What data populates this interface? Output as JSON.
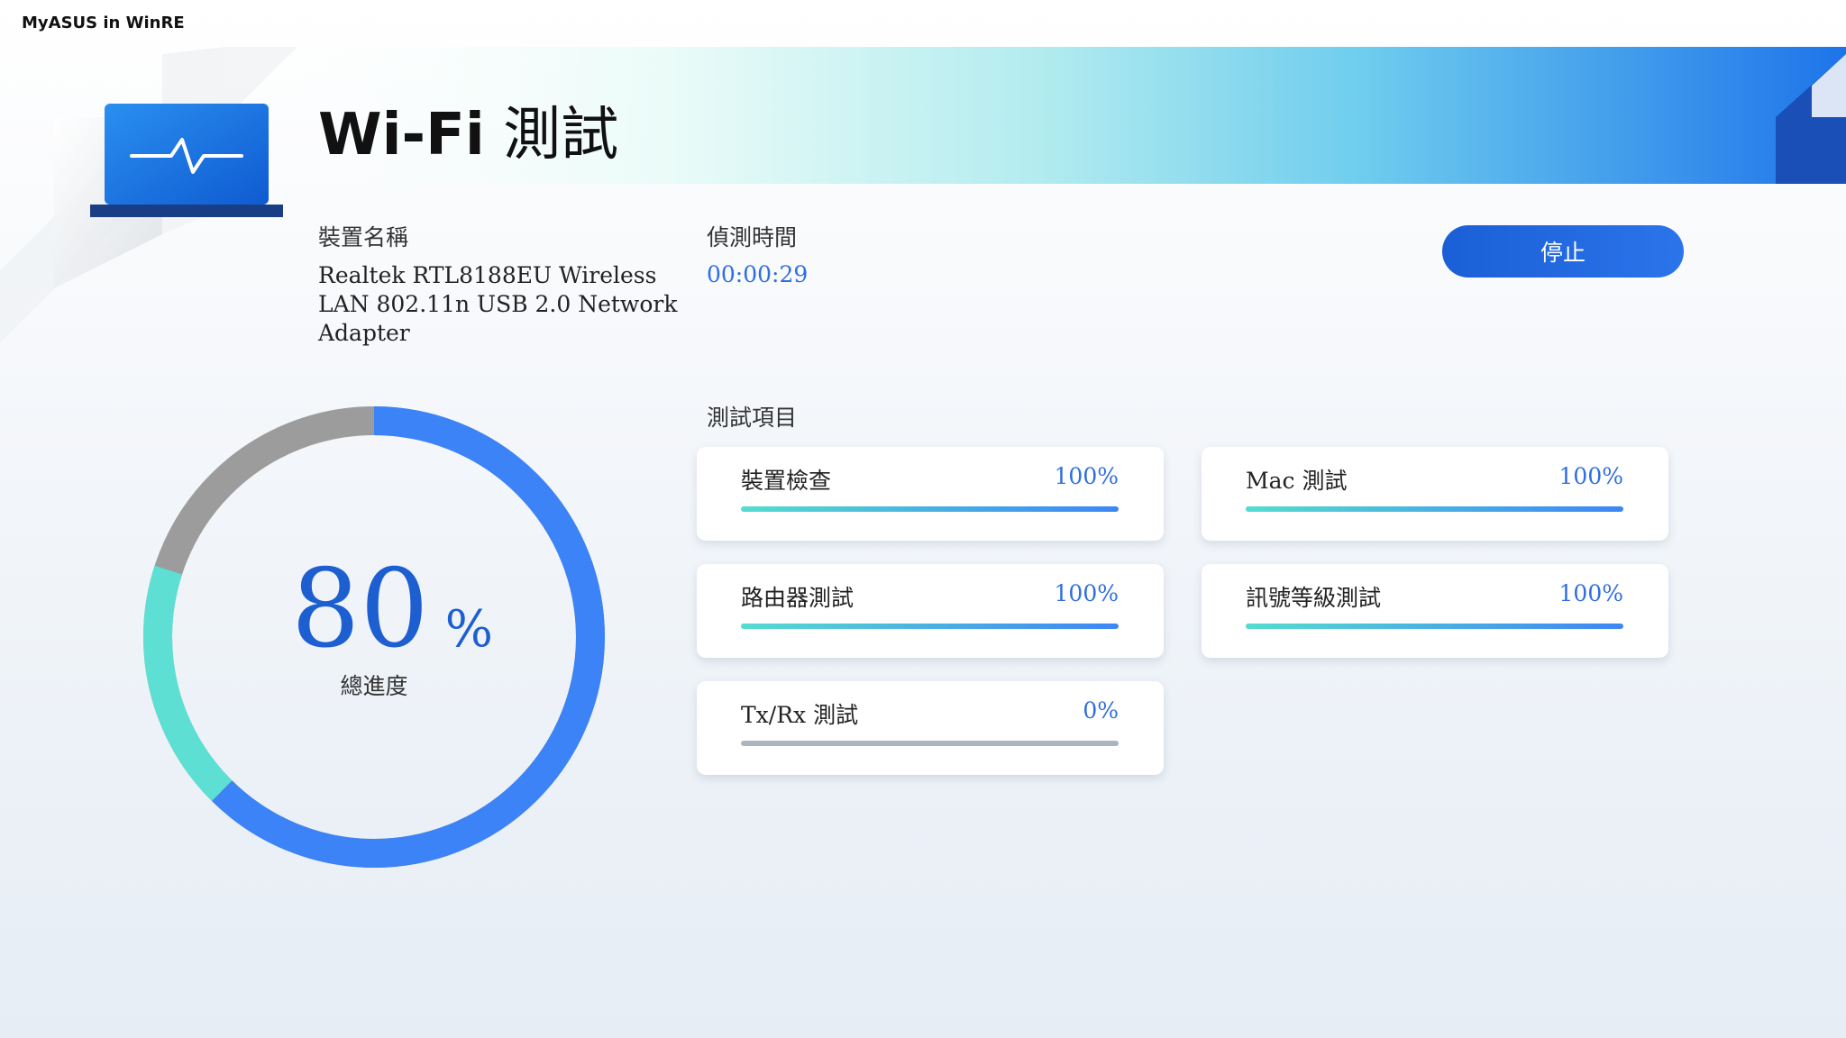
{
  "window": {
    "title": "MyASUS in WinRE"
  },
  "page": {
    "title_latin": "Wi-Fi",
    "title_cjk": "測試"
  },
  "device": {
    "label": "裝置名稱",
    "name": "Realtek RTL8188EU Wireless LAN 802.11n USB 2.0 Network Adapter"
  },
  "timer": {
    "label": "偵測時間",
    "value": "00:00:29"
  },
  "actions": {
    "stop_label": "停止"
  },
  "overall": {
    "value": "80",
    "unit": "%",
    "label": "總進度",
    "progress": 0.8
  },
  "tests": {
    "label": "測試項目",
    "items": [
      {
        "name": "裝置檢查",
        "percent": "100%",
        "progress": 1.0
      },
      {
        "name": "Mac 測試",
        "percent": "100%",
        "progress": 1.0
      },
      {
        "name": "路由器測試",
        "percent": "100%",
        "progress": 1.0
      },
      {
        "name": "訊號等級測試",
        "percent": "100%",
        "progress": 1.0
      },
      {
        "name": "Tx/Rx 測試",
        "percent": "0%",
        "progress": 0.0
      }
    ]
  },
  "colors": {
    "accent": "#2f6ee0",
    "button": "#1a5fd6",
    "ring_start": "#5ddfd3",
    "ring_end": "#3b83f6",
    "ring_track": "#9c9c9c"
  },
  "icons": {
    "app": "laptop-pulse-icon"
  }
}
